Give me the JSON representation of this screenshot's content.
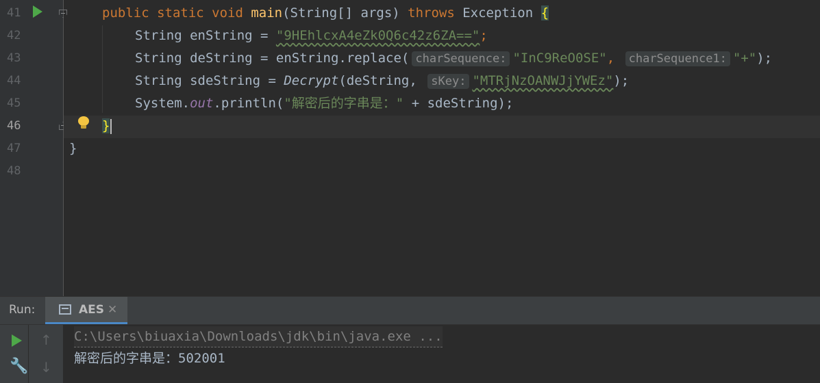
{
  "editor": {
    "line_numbers": [
      "41",
      "42",
      "43",
      "44",
      "45",
      "46",
      "47",
      "48"
    ],
    "lines": {
      "l41": {
        "kw1": "public static void ",
        "method": "main",
        "sig": "(String[] args) ",
        "kw2": "throws ",
        "exc": "Exception ",
        "brace": "{"
      },
      "l42": {
        "decl": "String enString = ",
        "str": "\"9HEhlcxA4eZk0Q6c42z6ZA==\"",
        "semi": ";"
      },
      "l43": {
        "pre": "String deString = enString.replace(",
        "hint1": "charSequence:",
        "str1": "\"InC9ReO0SE\"",
        "comma": ", ",
        "hint2": "charSequence1:",
        "str2": "\"+\"",
        "post": ");"
      },
      "l44": {
        "pre": "String sdeString = ",
        "fn": "Decrypt",
        "mid": "(deString, ",
        "hint": "sKey:",
        "str": "\"MTRjNzOANWJjYWEz\"",
        "post": ");"
      },
      "l45": {
        "pre": "System.",
        "field": "out",
        "mid": ".println(",
        "str": "\"解密后的字串是：\"",
        "post": " + sdeString);"
      },
      "l46": {
        "brace": "}"
      },
      "l47": {
        "brace": "}"
      }
    }
  },
  "run_panel": {
    "label": "Run:",
    "tab": {
      "label": "AES",
      "close": "✕"
    },
    "console": {
      "command": "C:\\Users\\biuaxia\\Downloads\\jdk\\bin\\java.exe ...",
      "output": "解密后的字串是：502001"
    },
    "toolbar": {
      "up": "↑",
      "down": "↓",
      "wrench": "🔧"
    }
  },
  "colors": {
    "keyword": "#cc7832",
    "string": "#6a8759",
    "method": "#ffc66d",
    "field": "#9876aa",
    "run_green": "#4ea849"
  }
}
